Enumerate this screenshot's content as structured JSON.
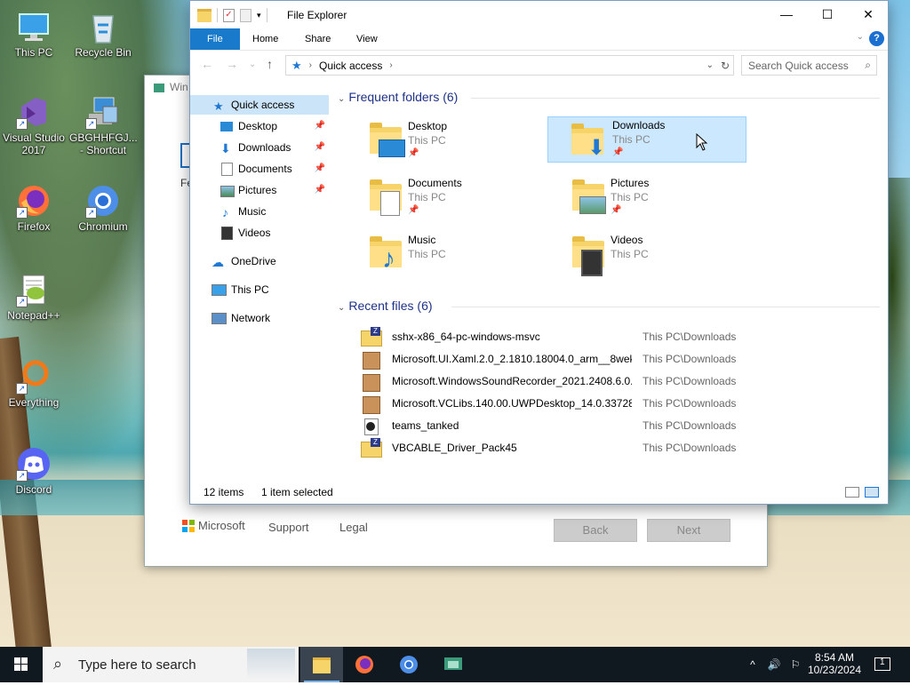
{
  "desktop": {
    "icons": [
      {
        "label": "This PC"
      },
      {
        "label": "Recycle Bin"
      },
      {
        "label": "Visual Studio 2017"
      },
      {
        "label": "GBGHHFGJ... - Shortcut"
      },
      {
        "label": "Firefox"
      },
      {
        "label": "Chromium"
      },
      {
        "label": "Notepad++"
      },
      {
        "label": "Everything"
      },
      {
        "label": "Discord"
      }
    ]
  },
  "background_window": {
    "title": "Win",
    "partial_text": "Fe",
    "brand": "Microsoft",
    "links": [
      "Support",
      "Legal"
    ],
    "back_label": "Back",
    "next_label": "Next"
  },
  "explorer": {
    "title": "File Explorer",
    "ribbon_tabs": [
      "File",
      "Home",
      "Share",
      "View"
    ],
    "address": {
      "segment": "Quick access"
    },
    "search_placeholder": "Search Quick access",
    "nav": {
      "quick_access": "Quick access",
      "items": [
        {
          "label": "Desktop",
          "pinned": true
        },
        {
          "label": "Downloads",
          "pinned": true
        },
        {
          "label": "Documents",
          "pinned": true
        },
        {
          "label": "Pictures",
          "pinned": true
        },
        {
          "label": "Music",
          "pinned": false
        },
        {
          "label": "Videos",
          "pinned": false
        }
      ],
      "onedrive": "OneDrive",
      "thispc": "This PC",
      "network": "Network"
    },
    "frequent": {
      "header": "Frequent folders (6)",
      "folders": [
        {
          "name": "Desktop",
          "location": "This PC",
          "pinned": true
        },
        {
          "name": "Downloads",
          "location": "This PC",
          "pinned": true
        },
        {
          "name": "Documents",
          "location": "This PC",
          "pinned": true
        },
        {
          "name": "Pictures",
          "location": "This PC",
          "pinned": true
        },
        {
          "name": "Music",
          "location": "This PC",
          "pinned": false
        },
        {
          "name": "Videos",
          "location": "This PC",
          "pinned": false
        }
      ]
    },
    "recent": {
      "header": "Recent files (6)",
      "files": [
        {
          "name": "sshx-x86_64-pc-windows-msvc",
          "location": "This PC\\Downloads",
          "icon": "zip-icon"
        },
        {
          "name": "Microsoft.UI.Xaml.2.0_2.1810.18004.0_arm__8wek...",
          "location": "This PC\\Downloads",
          "icon": "package-icon"
        },
        {
          "name": "Microsoft.WindowsSoundRecorder_2021.2408.6.0...",
          "location": "This PC\\Downloads",
          "icon": "package-icon"
        },
        {
          "name": "Microsoft.VCLibs.140.00.UWPDesktop_14.0.33728...",
          "location": "This PC\\Downloads",
          "icon": "package-icon"
        },
        {
          "name": "teams_tanked",
          "location": "This PC\\Downloads",
          "icon": "media-icon"
        },
        {
          "name": "VBCABLE_Driver_Pack45",
          "location": "This PC\\Downloads",
          "icon": "zip-icon"
        }
      ]
    },
    "status": {
      "count": "12 items",
      "selected": "1 item selected"
    }
  },
  "taskbar": {
    "search_placeholder": "Type here to search",
    "time": "8:54 AM",
    "date": "10/23/2024",
    "notification_count": "1"
  }
}
